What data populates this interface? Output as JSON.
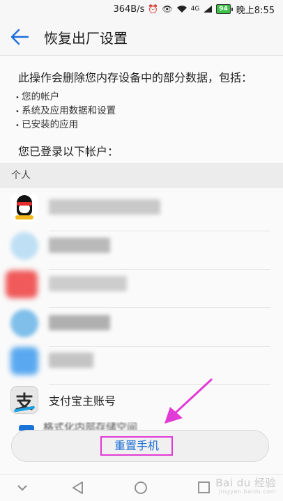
{
  "status_bar": {
    "speed": "364B/s",
    "signal": "4G",
    "battery": "94",
    "time": "晚上8:55"
  },
  "header": {
    "title": "恢复出厂设置",
    "back_icon": "back-arrow-icon"
  },
  "description": "此操作会删除您内存设备中的部分数据，包括：",
  "bullets": [
    "您的帐户",
    "系统及应用数据和设置",
    "已安装的应用"
  ],
  "accounts_title": "您已登录以下帐户：",
  "section_label": "个人",
  "accounts": [
    {
      "icon": "qq-penguin-icon",
      "name_blurred": true
    },
    {
      "icon": "blurred-app-icon",
      "name_blurred": true
    },
    {
      "icon": "blurred-app-icon",
      "name_blurred": true
    },
    {
      "icon": "blurred-app-icon",
      "name_blurred": true
    },
    {
      "icon": "blurred-app-icon",
      "name_blurred": true
    },
    {
      "icon": "alipay-icon",
      "name": "支付宝主账号"
    }
  ],
  "partial_row_text": "格式化内部存储空间",
  "reset_button": "重置手机",
  "watermark": "Bai du 经验",
  "watermark_sub": "jingyan.baidu.com",
  "colors": {
    "accent_blue": "#1e6fd9",
    "highlight_magenta": "#e23ad6",
    "battery_green": "#3cc248"
  }
}
